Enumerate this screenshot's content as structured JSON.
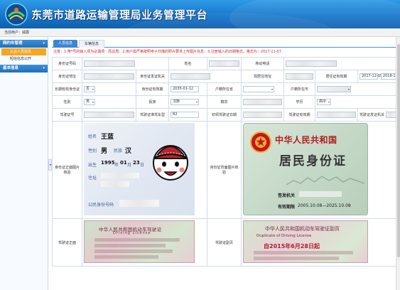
{
  "app": {
    "title": "东莞市道路运输管理局业务管理平台",
    "logo_label": "东莞"
  },
  "userbar": {
    "label": "当前用户：",
    "username": "威展"
  },
  "sidebar": {
    "groups": [
      {
        "label": "网约车管理",
        "items": [
          {
            "label": "从业人员信息",
            "active": true
          },
          {
            "label": "短信信息公开",
            "active": false
          }
        ]
      },
      {
        "label": "基本信息",
        "items": []
      }
    ],
    "collapse_glyph": "◂"
  },
  "tabs": [
    {
      "label": "人员信息",
      "active": true
    },
    {
      "label": "车辆信息",
      "active": false
    }
  ],
  "notice": "注意：1.带*号的输入项为必填项　原总局：2.用户需严格按照电子扫描的照片要求上传图片信息：3.注册输入的日期格式，格式为：2017-11-07",
  "form": {
    "row1": {
      "id_no_label": "身份证号码",
      "name_label": "姓名",
      "mobile_label": "移动电话"
    },
    "row2": {
      "id_addr_label": "身份证地址",
      "issuer_label": "身份证发证机关",
      "current_addr_label": "现居住地址",
      "residence_valid_label": "居住证有效期",
      "residence_from": "2017-12-05",
      "residence_to": "2018-12-05"
    },
    "row3": {
      "long_term_label": "长期有效身份证",
      "long_term_value": "否",
      "id_valid_label": "身份证有效期",
      "id_valid_date": "2035-01-12",
      "hukou_label": "户籍所在省",
      "hukou_city_label": "户籍所在市"
    },
    "row4": {
      "gender_label": "性别",
      "gender_value": "男",
      "ethnic_label": "民族",
      "ethnic_value": "汉族",
      "native_label": "籍贯",
      "education_label": "学历",
      "education_value": "高中"
    },
    "row5": {
      "license_no_label": "驾驶证号",
      "license_type_label": "驾驶证准驾车型",
      "license_type_value": "B2",
      "first_issue_label": "初领驾驶证日期",
      "license_valid_label": "驾驶证有效期",
      "license_issuer_label": "驾驶证发证机关"
    },
    "row6": {
      "id_front_label": "身份证正面图片核验",
      "id_back_label": "身份证背面图片核验"
    },
    "row7": {
      "license_front_label": "驾驶证正面",
      "license_back_label": "驾驶证副页"
    }
  },
  "id_front": {
    "name_field": "姓名",
    "name_value": "王蓝",
    "sex_field": "性别",
    "sex_value": "男",
    "ethnic_field": "民族",
    "ethnic_value": "汉",
    "birth_field": "出生",
    "birth_y": "1995",
    "birth_y_unit": "年",
    "birth_m": "01",
    "birth_m_unit": "月",
    "birth_d": "23",
    "birth_d_unit": "日",
    "addr_field": "住址",
    "idno_field": "公民身份号码"
  },
  "id_back": {
    "country": "中华人民共和国",
    "title": "居民身份证",
    "issuer_field": "签发机关",
    "valid_field": "有效期限",
    "valid_value": "2005.10.08—2025.10.08"
  },
  "license_front": {
    "title": "中华人民共和国机动车驾驶证",
    "sub": "Driving License"
  },
  "license_back": {
    "title": "中华人民共和国机动车驾驶证副页",
    "sub_line": "Duplicate of Driving License",
    "red": "自2015年6月28日起"
  },
  "colors": {
    "header": "#1677cc",
    "accent_active": "#f5a623",
    "notice": "#e02020",
    "tab_active": "#3a86d4"
  }
}
